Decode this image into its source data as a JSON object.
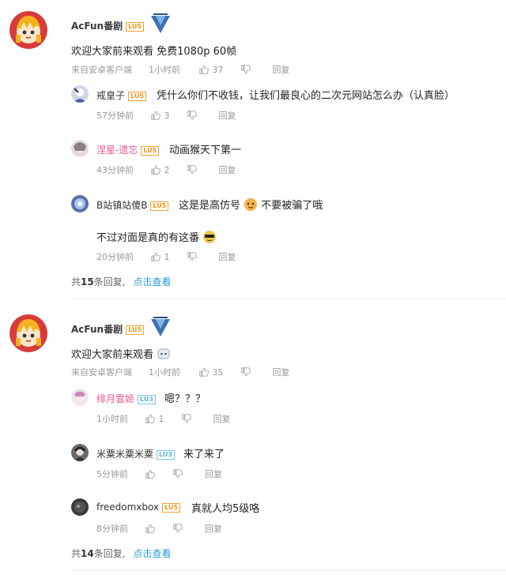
{
  "threads": [
    {
      "author": "AcFun番剧",
      "level": "LU5",
      "content": "欢迎大家前来观看 免费1080p 60帧",
      "source": "来自安卓客户端",
      "time": "1小时前",
      "likes": "37",
      "reply_label": "回复",
      "replies": [
        {
          "name": "戒皇子",
          "level": "LU5",
          "content": "凭什么你们不收钱，让我们最良心的二次元网站怎么办（认真脸）",
          "time": "57分钟前",
          "likes": "3",
          "reply_label": "回复"
        },
        {
          "name": "涅星-遗忘",
          "level": "LU5",
          "content": "动画猴天下第一",
          "time": "43分钟前",
          "likes": "2",
          "reply_label": "回复"
        },
        {
          "name": "B站镇站傻B",
          "level": "LU5",
          "content": "这是是高仿号",
          "content_after": "不要被骗了哦",
          "content2": "不过对面是真的有这番",
          "time": "20分钟前",
          "likes": "1",
          "reply_label": "回复"
        }
      ],
      "total_prefix": "共",
      "total_count": "15",
      "total_suffix": "条回复,",
      "see_label": "点击查看"
    },
    {
      "author": "AcFun番剧",
      "level": "LU5",
      "content": "欢迎大家前来观看",
      "source": "来自安卓客户端",
      "time": "1小时前",
      "likes": "35",
      "reply_label": "回复",
      "replies": [
        {
          "name": "绯月雲姬",
          "level": "LU3",
          "content": "嗯？？？",
          "time": "1小时前",
          "likes": "1",
          "reply_label": "回复"
        },
        {
          "name": "米粟米粟米粟",
          "level": "LU3",
          "content": "来了来了",
          "time": "5分钟前",
          "likes": "",
          "reply_label": "回复"
        },
        {
          "name": "freedomxbox",
          "level": "LU5",
          "content": "真就人均5级咯",
          "time": "8分钟前",
          "likes": "",
          "reply_label": "回复"
        }
      ],
      "total_prefix": "共",
      "total_count": "14",
      "total_suffix": "条回复,",
      "see_label": "点击查看"
    }
  ],
  "colors": {
    "accent": "#2b9bd4",
    "level_orange": "#f39418",
    "level_blue": "#5eb0e0",
    "name_pink": "#e6568a"
  },
  "icons": {
    "like": "thumb-up-icon",
    "dislike": "thumb-down-icon",
    "badge": "acfun-v-badge-icon"
  }
}
